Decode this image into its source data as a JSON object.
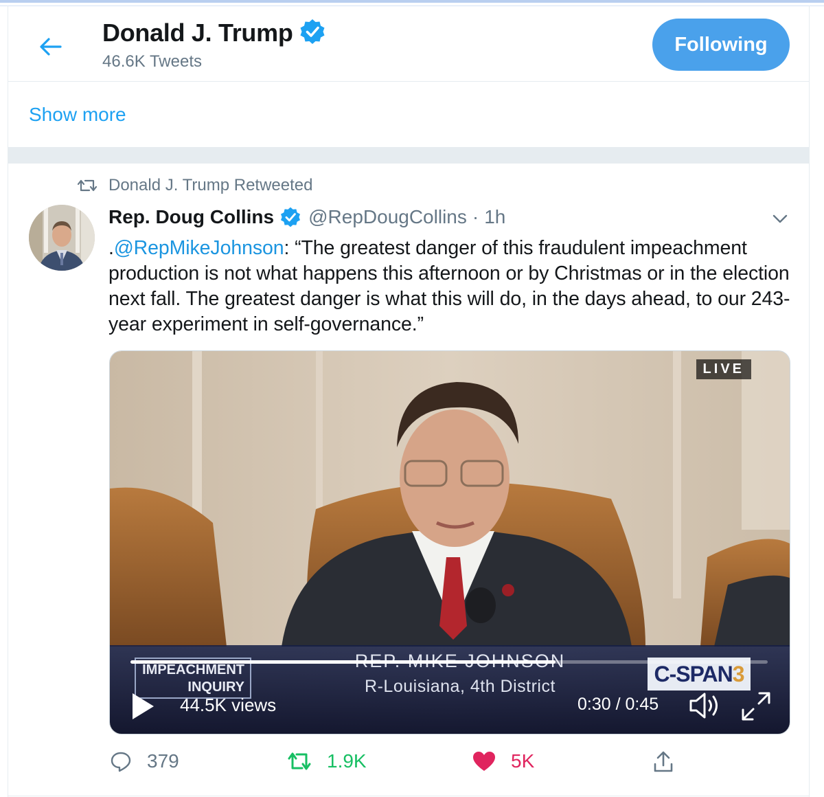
{
  "header": {
    "name": "Donald J. Trump",
    "tweet_count": "46.6K Tweets",
    "follow_button": "Following"
  },
  "show_more": "Show more",
  "retweet_context": "Donald J. Trump Retweeted",
  "tweet": {
    "author_name": "Rep. Doug Collins",
    "author_handle": "@RepDougCollins",
    "separator": "·",
    "time": "1h",
    "text_prefix": ".",
    "mention": "@RepMikeJohnson",
    "text_body": ": “The greatest danger of this fraudulent impeachment production is not what happens this afternoon or by Christmas or in the election next fall. The greatest danger is what this will do, in the days ahead, to our 243-year experiment in self-governance.”"
  },
  "video": {
    "live_badge": "LIVE",
    "chyron_box_line1": "IMPEACHMENT",
    "chyron_box_line2": "INQUIRY",
    "chyron_name": "REP. MIKE JOHNSON",
    "chyron_district": "R-Louisiana, 4th District",
    "network_logo": "C-SPAN",
    "network_logo_num": "3",
    "views": "44.5K views",
    "timecode": "0:30 / 0:45",
    "progress": 0.667
  },
  "actions": {
    "replies": "379",
    "retweets": "1.9K",
    "likes": "5K"
  },
  "colors": {
    "accent": "#1da1f2",
    "follow_bg": "#4aa1eb",
    "retweet_active": "#17bf63",
    "like_active": "#e0245e",
    "muted": "#657786"
  },
  "icons": [
    "back-arrow-icon",
    "verified-badge-icon",
    "retweet-icon",
    "chevron-down-icon",
    "play-icon",
    "volume-icon",
    "fullscreen-icon",
    "reply-icon",
    "like-heart-icon",
    "share-icon"
  ]
}
